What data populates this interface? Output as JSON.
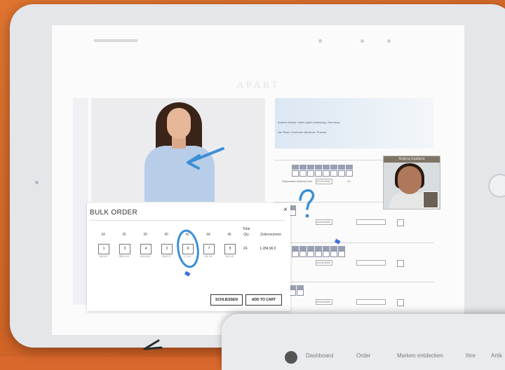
{
  "brand": "APART",
  "bulk_order": {
    "title": "BULK ORDER",
    "close": "×",
    "sizes": [
      "34",
      "36",
      "38",
      "40",
      "42",
      "44",
      "46"
    ],
    "quantities": [
      "1",
      "3",
      "4",
      "2",
      "6",
      "7",
      "5"
    ],
    "prices": [
      "133,4 €",
      "503,14 €",
      "813,14 €",
      "35,67 €",
      "1,7,4 €",
      "111,9 €",
      "111,9 €"
    ],
    "total_label": "Total",
    "qty_label": "Qty",
    "sum_label": "Zeilensumme",
    "total_qty": "24",
    "total_sum": "1.284,96 €",
    "close_button": "SCHLIESSEN",
    "add_to_cart_button": "ADD TO CART"
  },
  "rep_panel": {
    "line1": "Andrea Gaidar: Sales Agent (Hamburg, Germany)",
    "line2": "Jan Ryan: Customer (Moscow, Russia)"
  },
  "order_rows": {
    "delivery_label": "Requested delivery from",
    "delivery_date": "13.04.2021",
    "to_label": "to",
    "cell_values": [
      "0",
      "0",
      "0",
      "0",
      "0",
      "0",
      "0"
    ]
  },
  "video_call": {
    "caller": "Andrea Gaidarra"
  },
  "second_nav": [
    "Dashboard",
    "Order",
    "Marken entdecken",
    "Ihre",
    "Artik"
  ],
  "colors": {
    "background": "#d9682c",
    "annotation": "#3c8fd6"
  }
}
